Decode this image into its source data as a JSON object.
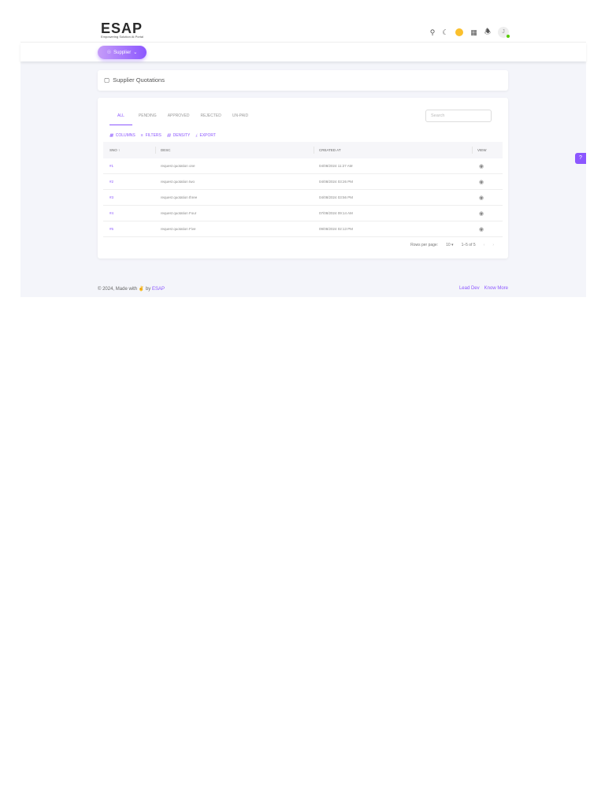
{
  "logo": {
    "text": "ESAP",
    "tagline": "Empowering Solution At Portal"
  },
  "header": {
    "avatar_initial": "J"
  },
  "nav": {
    "role_label": "Supplier"
  },
  "page": {
    "title": "Supplier Quotations"
  },
  "tabs": [
    "ALL",
    "PENDING",
    "APPROVED",
    "REJECTED",
    "UN-PAID"
  ],
  "search": {
    "placeholder": "Search"
  },
  "toolbar": {
    "columns": "COLUMNS",
    "filters": "FILTERS",
    "density": "DENSITY",
    "export": "EXPORT"
  },
  "table": {
    "headers": {
      "sno": "SNO",
      "desc": "DESC",
      "created": "CREATED AT",
      "view": "VIEW"
    },
    "rows": [
      {
        "sno": "#1",
        "desc": "request quotation one",
        "created": "04/08/2024 11:27 AM"
      },
      {
        "sno": "#2",
        "desc": "request quotation two",
        "created": "04/08/2024 03:26 PM"
      },
      {
        "sno": "#3",
        "desc": "request quotation three",
        "created": "04/08/2024 03:56 PM"
      },
      {
        "sno": "#4",
        "desc": "request quotation Four",
        "created": "07/08/2024 09:14 AM"
      },
      {
        "sno": "#5",
        "desc": "request quotation Five",
        "created": "09/08/2024 02:13 PM"
      }
    ]
  },
  "pagination": {
    "rows_label": "Rows per page:",
    "rows_value": "10",
    "range": "1–5 of 5"
  },
  "footer": {
    "copyright": "© 2024, Made with",
    "by": "by",
    "brand": "ESAP",
    "lead_dev": "Lead Dev",
    "know_more": "Know More"
  }
}
